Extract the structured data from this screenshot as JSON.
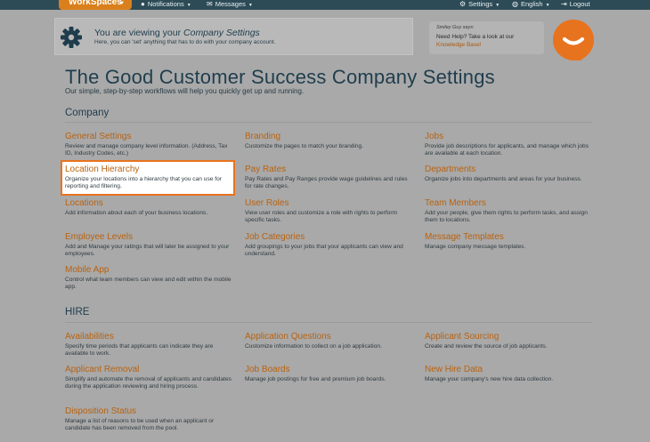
{
  "topbar": {
    "workspaces": "WorkSpaces",
    "notifications": "Notifications",
    "messages": "Messages",
    "settings": "Settings",
    "language": "English",
    "logout": "Logout"
  },
  "banner": {
    "title_prefix": "You are viewing your ",
    "title_em": "Company Settings",
    "subtitle": "Here, you can 'set' anything that has to do with your company account."
  },
  "help": {
    "says": "Smiley Guy says:",
    "text": "Need Help? Take a look at our",
    "link": "Knowledge Base!"
  },
  "page": {
    "title": "The Good Customer Success Company Settings",
    "subtitle": "Our simple, step-by-step workflows will help you quickly get up and running."
  },
  "sections": {
    "company": "Company",
    "hire": "HIRE"
  },
  "company_items": [
    {
      "title": "General Settings",
      "desc": "Review and manage company level information. (Address, Tax ID, Industry Codes, etc.)"
    },
    {
      "title": "Branding",
      "desc": "Customize the pages to match your branding."
    },
    {
      "title": "Jobs",
      "desc": "Provide job descriptions for applicants, and manage which jobs are available at each location."
    },
    {
      "title": "Location Hierarchy",
      "desc": "Organize your locations into a hierarchy that you can use for reporting and filtering."
    },
    {
      "title": "Pay Rates",
      "desc": "Pay Rates and Pay Ranges provide wage guidelines and rules for rate changes."
    },
    {
      "title": "Departments",
      "desc": "Organize jobs into departments and areas for your business."
    },
    {
      "title": "Locations",
      "desc": "Add information about each of your business locations."
    },
    {
      "title": "User Roles",
      "desc": "View user roles and customize a role with rights to perform specific tasks."
    },
    {
      "title": "Team Members",
      "desc": "Add your people, give them rights to perform tasks, and assign them to locations."
    },
    {
      "title": "Employee Levels",
      "desc": "Add and Manage your ratings that will later be assigned to your employees."
    },
    {
      "title": "Job Categories",
      "desc": "Add groupings to your jobs that your applicants can view and understand."
    },
    {
      "title": "Message Templates",
      "desc": "Manage company message templates."
    },
    {
      "title": "Mobile App",
      "desc": "Control what team members can view and edit within the mobile app."
    }
  ],
  "hire_items": [
    {
      "title": "Availabilities",
      "desc": "Specify time periods that applicants can indicate they are available to work."
    },
    {
      "title": "Application Questions",
      "desc": "Customize information to collect on a job application."
    },
    {
      "title": "Applicant Sourcing",
      "desc": "Create and review the source of job applicants."
    },
    {
      "title": "Applicant Removal",
      "desc": "Simplify and automate the removal of applicants and candidates during the application reviewing and hiring process."
    },
    {
      "title": "Job Boards",
      "desc": "Manage job postings for free and premium job boards."
    },
    {
      "title": "New Hire Data",
      "desc": "Manage your company's new hire data collection."
    },
    {
      "title": "Disposition Status",
      "desc": "Manage a list of reasons to be used when an applicant or candidate has been removed from the pool."
    }
  ],
  "colors": {
    "accent": "#e8731f",
    "link": "#b9620f",
    "topbar": "#2d4b57"
  }
}
